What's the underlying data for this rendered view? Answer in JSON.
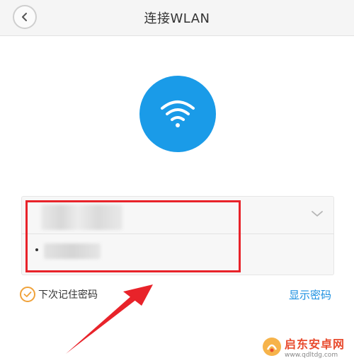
{
  "header": {
    "title": "连接WLAN",
    "back_icon": "chevron-left-icon"
  },
  "wifi": {
    "icon": "wifi-icon",
    "color": "#1a9be8"
  },
  "form": {
    "network_name": "",
    "password_mask": "•",
    "dropdown_icon": "chevron-down-icon"
  },
  "remember": {
    "label": "下次记住密码",
    "checked": true,
    "color": "#f0a23a"
  },
  "show_password": {
    "label": "显示密码",
    "color": "#1a8fe0"
  },
  "annotation": {
    "color": "#e8232a",
    "type": "highlight-box-with-arrow"
  },
  "watermark": {
    "text": "启东安卓网",
    "url": "www.qdltdg.com"
  }
}
